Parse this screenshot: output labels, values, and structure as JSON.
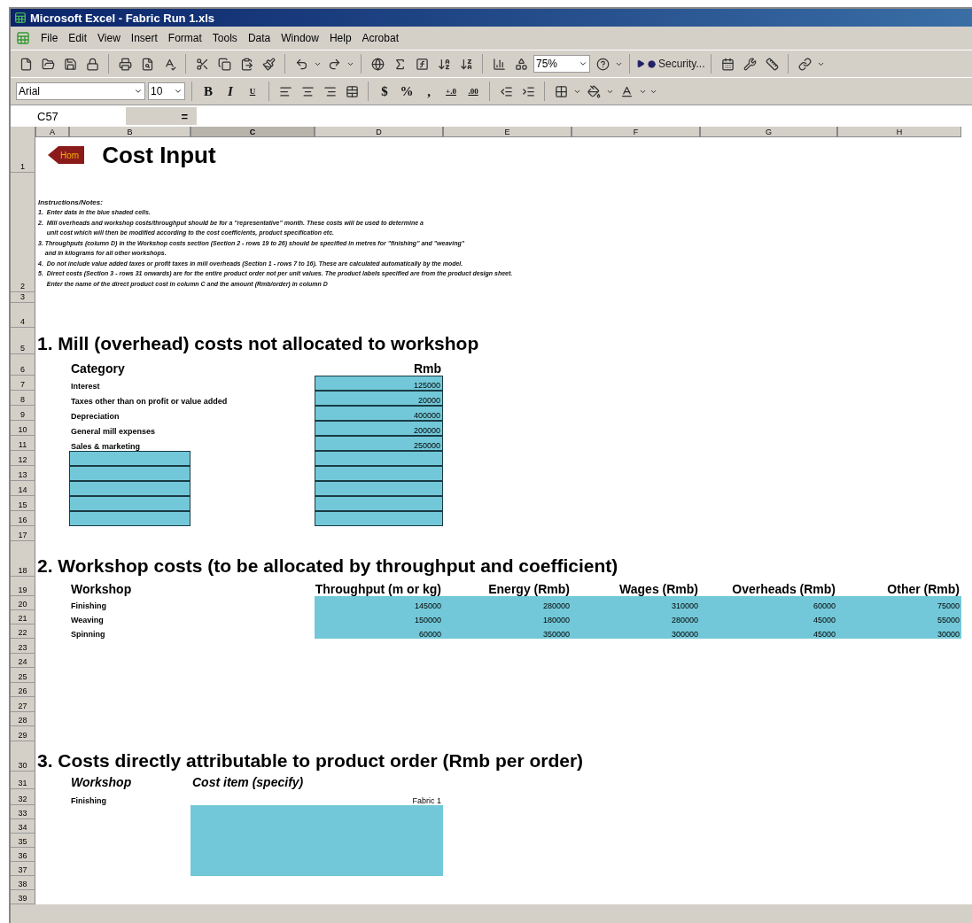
{
  "window": {
    "title": "Microsoft Excel - Fabric Run 1.xls"
  },
  "menu": [
    "File",
    "Edit",
    "View",
    "Insert",
    "Format",
    "Tools",
    "Data",
    "Window",
    "Help",
    "Acrobat"
  ],
  "toolbar": {
    "zoom": "75%",
    "security": "Security..."
  },
  "format_toolbar": {
    "font": "Arial",
    "size": "10",
    "style_buttons": [
      "B",
      "I",
      "U"
    ],
    "number_buttons": [
      "$",
      "%",
      ","
    ],
    "decimal_buttons": [
      "+.0",
      ".00"
    ]
  },
  "formula_bar": {
    "name_box": "C57",
    "equals": "="
  },
  "columns": [
    {
      "label": "A",
      "selected": false
    },
    {
      "label": "B",
      "selected": false
    },
    {
      "label": "C",
      "selected": true
    },
    {
      "label": "D",
      "selected": false
    },
    {
      "label": "E",
      "selected": false
    },
    {
      "label": "F",
      "selected": false
    },
    {
      "label": "G",
      "selected": false
    },
    {
      "label": "H",
      "selected": false
    }
  ],
  "row_numbers": [
    "1",
    "2",
    "3",
    "4",
    "5",
    "6",
    "7",
    "8",
    "9",
    "10",
    "11",
    "12",
    "13",
    "14",
    "15",
    "16",
    "17",
    "18",
    "19",
    "20",
    "21",
    "22",
    "23",
    "24",
    "25",
    "26",
    "27",
    "28",
    "29",
    "30",
    "31",
    "32",
    "33",
    "34",
    "35",
    "36",
    "37",
    "38",
    "39"
  ],
  "sheet": {
    "home_button": "Hom",
    "title": "Cost Input",
    "instructions": {
      "heading": "Instructions/Notes:",
      "lines": [
        "1.  Enter data in the blue shaded cells.",
        "2.  Mill overheads and workshop costs/throughput should be for a \"representative\" month. These costs will be used to determine a",
        "     unit cost which will then be modified according to the cost coefficients, product specification etc.",
        "3. Throughputs (column D) in the Workshop costs section (Section 2 - rows 19 to 26) should be specified in metres for \"finishing\" and \"weaving\"",
        "    and in kilograms for all other workshops.",
        "4.  Do not include value added taxes or profit taxes in mill overheads (Section 1 - rows 7 to 16). These are calculated automatically by the model.",
        "5.  Direct costs (Section 3 - rows 31 onwards) are for the entire product order not per unit values. The product labels specified are from the product design sheet.",
        "     Enter the name of the direct product cost in column C and the amount (Rmb/order) in column D"
      ]
    },
    "section_1": {
      "heading": "1. Mill (overhead) costs not allocated to workshop",
      "columns": [
        "Category",
        "Rmb"
      ],
      "rows": [
        {
          "kind": "entry",
          "category": "Interest",
          "rmb": "125000"
        },
        {
          "kind": "entry",
          "category": "Taxes other than on profit or value added",
          "rmb": "20000"
        },
        {
          "kind": "entry",
          "category": "Depreciation",
          "rmb": "400000"
        },
        {
          "kind": "entry",
          "category": "General mill expenses",
          "rmb": "200000"
        },
        {
          "kind": "entry",
          "category": "Sales & marketing",
          "rmb": "250000"
        },
        {
          "kind": "blank"
        },
        {
          "kind": "blank"
        },
        {
          "kind": "blank"
        },
        {
          "kind": "blank"
        },
        {
          "kind": "blank"
        }
      ]
    },
    "section_2": {
      "heading": "2. Workshop costs (to be allocated by throughput and coefficient)",
      "columns": [
        "Workshop",
        "Throughput (m or kg)",
        "Energy (Rmb)",
        "Wages (Rmb)",
        "Overheads (Rmb)",
        "Other (Rmb)"
      ],
      "rows": [
        {
          "workshop": "Finishing",
          "values": [
            "145000",
            "280000",
            "310000",
            "60000",
            "75000"
          ]
        },
        {
          "workshop": "Weaving",
          "values": [
            "150000",
            "180000",
            "280000",
            "45000",
            "55000"
          ]
        },
        {
          "workshop": "Spinning",
          "values": [
            "60000",
            "350000",
            "300000",
            "45000",
            "30000"
          ]
        }
      ]
    },
    "section_3": {
      "heading": "3. Costs directly attributable to product order (Rmb per order)",
      "columns": [
        "Workshop",
        "Cost item (specify)"
      ],
      "rows": [
        {
          "workshop": "Finishing",
          "product": "Fabric 1"
        }
      ]
    }
  }
}
